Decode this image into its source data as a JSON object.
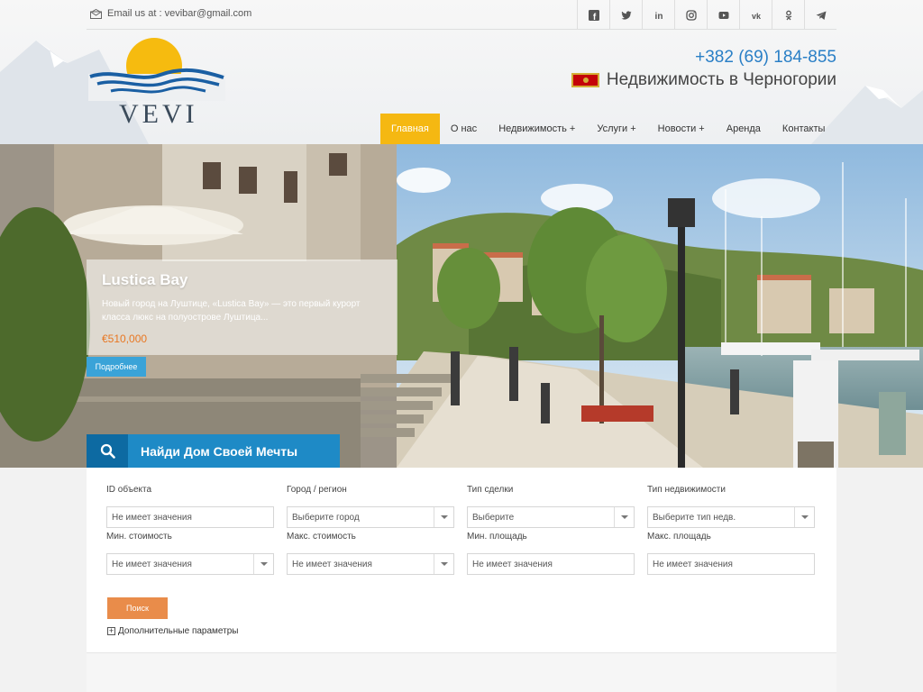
{
  "topbar": {
    "email": "Email us at : vevibar@gmail.com",
    "social": [
      "facebook-icon",
      "twitter-icon",
      "linkedin-icon",
      "instagram-icon",
      "youtube-icon",
      "vk-icon",
      "odnoklassniki-icon",
      "telegram-icon"
    ]
  },
  "brand": {
    "logo_text": "VEVI",
    "phone": "+382 (69) 184-855",
    "tagline": "Недвижимость в Черногории"
  },
  "nav": {
    "items": [
      {
        "label": "Главная",
        "active": true
      },
      {
        "label": "О нас"
      },
      {
        "label": "Недвижимость +"
      },
      {
        "label": "Услуги +"
      },
      {
        "label": "Новости +"
      },
      {
        "label": "Аренда"
      },
      {
        "label": "Контакты"
      }
    ]
  },
  "hero": {
    "slide_title": "Lustica Bay",
    "slide_desc": "Новый город на Луштице, «Lustica Bay» — это первый курорт класса люкс на полуострове Луштица...",
    "slide_price": "€510,000",
    "more_label": "Подробнее",
    "dream_label": "Найди Дом Своей Мечты"
  },
  "search": {
    "fields": [
      {
        "label": "ID объекта",
        "value": "Не имеет значения",
        "type": "input"
      },
      {
        "label": "Город / регион",
        "value": "Выберите город",
        "type": "select"
      },
      {
        "label": "Тип сделки",
        "value": "Выберите",
        "type": "select"
      },
      {
        "label": "Тип недвижимости",
        "value": "Выберите тип недв.",
        "type": "select"
      },
      {
        "label": "Мин. стоимость",
        "value": "Не имеет значения",
        "type": "select"
      },
      {
        "label": "Макс. стоимость",
        "value": "Не имеет значения",
        "type": "select"
      },
      {
        "label": "Мин. площадь",
        "value": "Не имеет значения",
        "type": "input"
      },
      {
        "label": "Макс. площадь",
        "value": "Не имеет значения",
        "type": "input"
      }
    ],
    "search_label": "Поиск",
    "more_params_label": "Дополнительные параметры"
  },
  "colors": {
    "accent": "#f5b812",
    "blue": "#1e8ac6",
    "orange": "#e98c4a",
    "phone": "#2a7fc6"
  }
}
